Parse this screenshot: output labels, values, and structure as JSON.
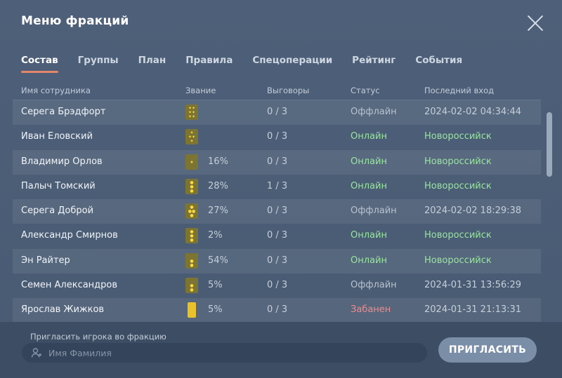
{
  "window": {
    "title": "Меню фракций"
  },
  "tabs": [
    {
      "label": "Состав",
      "active": true
    },
    {
      "label": "Группы",
      "active": false
    },
    {
      "label": "План",
      "active": false
    },
    {
      "label": "Правила",
      "active": false
    },
    {
      "label": "Спецоперации",
      "active": false
    },
    {
      "label": "Рейтинг",
      "active": false
    },
    {
      "label": "События",
      "active": false
    }
  ],
  "table": {
    "headers": {
      "name": "Имя сотрудника",
      "rank": "Звание",
      "warnings": "Выговоры",
      "status": "Статус",
      "last_login": "Последний вход"
    },
    "rows": [
      {
        "name": "Серега Брэдфорт",
        "rank_icon": "rank-six-stars-icon",
        "progress": "",
        "warnings": "0 / 3",
        "status": "Оффлайн",
        "status_type": "offline",
        "last_login": "2024-02-02 04:34:44"
      },
      {
        "name": "Иван Еловский",
        "rank_icon": "rank-four-stars-icon",
        "progress": "",
        "warnings": "0 / 3",
        "status": "Онлайн",
        "status_type": "online",
        "last_login": "Новороссийск"
      },
      {
        "name": "Владимир Орлов",
        "rank_icon": "rank-star-icon",
        "progress": "16%",
        "warnings": "0 / 3",
        "status": "Онлайн",
        "status_type": "online",
        "last_login": "Новороссийск"
      },
      {
        "name": "Палыч Томский",
        "rank_icon": "rank-three-dots-icon",
        "progress": "28%",
        "warnings": "1 / 3",
        "status": "Онлайн",
        "status_type": "online",
        "last_login": "Новороссийск"
      },
      {
        "name": "Серега Доброй",
        "rank_icon": "rank-four-dots-icon",
        "progress": "27%",
        "warnings": "0 / 3",
        "status": "Оффлайн",
        "status_type": "offline",
        "last_login": "2024-02-02 18:29:38"
      },
      {
        "name": "Александр Смирнов",
        "rank_icon": "rank-three-dots-icon",
        "progress": "2%",
        "warnings": "0 / 3",
        "status": "Онлайн",
        "status_type": "online",
        "last_login": "Новороссийск"
      },
      {
        "name": "Эн Райтер",
        "rank_icon": "rank-two-dots-icon",
        "progress": "54%",
        "warnings": "0 / 3",
        "status": "Онлайн",
        "status_type": "online",
        "last_login": "Новороссийск"
      },
      {
        "name": "Семен Александров",
        "rank_icon": "rank-two-dots-icon",
        "progress": "5%",
        "warnings": "0 / 3",
        "status": "Оффлайн",
        "status_type": "offline",
        "last_login": "2024-01-31 13:56:29"
      },
      {
        "name": "Ярослав Жижков",
        "rank_icon": "rank-plain-icon",
        "progress": "5%",
        "warnings": "0 / 3",
        "status": "Забанен",
        "status_type": "banned",
        "last_login": "2024-01-31 21:13:31"
      }
    ]
  },
  "invite": {
    "label": "Пригласить игрока во фракцию",
    "placeholder": "Имя Фамилия",
    "button": "ПРИГЛАСИТЬ"
  },
  "colors": {
    "accent": "#e2856a",
    "online": "#97e79c",
    "banned": "#f08a8a",
    "offline": "#b8c2ce"
  }
}
